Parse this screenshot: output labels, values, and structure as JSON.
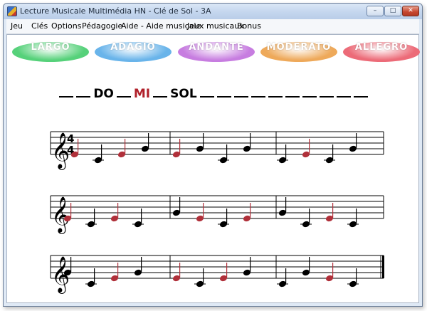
{
  "window": {
    "title": "Lecture Musicale Multimédia HN - Clé de Sol - 3A",
    "buttons": {
      "minimize": "–",
      "maximize": "□",
      "close": "✕"
    }
  },
  "menu": [
    "Jeu",
    "Clés",
    "Options",
    "Pédagogie",
    "Aide - Aide musicale",
    "Jeux musicaux",
    "Bonus"
  ],
  "tempos": [
    {
      "label": "LARGO",
      "color": "#56d17a"
    },
    {
      "label": "ADAGIO",
      "color": "#69b4ea"
    },
    {
      "label": "ANDANTE",
      "color": "#c77de0"
    },
    {
      "label": "MODERATO",
      "color": "#eea95a"
    },
    {
      "label": "ALLEGRO",
      "color": "#ec6b78"
    }
  ],
  "answer": {
    "tokens": [
      "_",
      "_",
      "DO",
      "_",
      "MI",
      "_",
      "SOL",
      "_",
      "_",
      "_",
      "_",
      "_",
      "_",
      "_",
      "_",
      "_",
      "_"
    ],
    "highlight_index": 4,
    "highlight_color": "#b0202a"
  },
  "music": {
    "clef": "treble",
    "time_signature": {
      "top": "4",
      "bottom": "4"
    },
    "note_colors": {
      "answered": "#b0303a",
      "pending": "#000000"
    },
    "staves": [
      {
        "measures": [
          [
            {
              "step": 2,
              "state": "answered"
            },
            {
              "step": 0,
              "state": "pending"
            },
            {
              "step": 2,
              "state": "answered"
            },
            {
              "step": 4,
              "state": "pending"
            }
          ],
          [
            {
              "step": 2,
              "state": "answered"
            },
            {
              "step": 4,
              "state": "pending"
            },
            {
              "step": 0,
              "state": "pending"
            },
            {
              "step": 4,
              "state": "pending"
            }
          ],
          [
            {
              "step": 0,
              "state": "pending"
            },
            {
              "step": 2,
              "state": "answered"
            },
            {
              "step": 0,
              "state": "pending"
            },
            {
              "step": 4,
              "state": "pending"
            }
          ]
        ]
      },
      {
        "measures": [
          [
            {
              "step": 2,
              "state": "answered"
            },
            {
              "step": 0,
              "state": "pending"
            },
            {
              "step": 2,
              "state": "answered"
            },
            {
              "step": 0,
              "state": "pending"
            }
          ],
          [
            {
              "step": 4,
              "state": "pending"
            },
            {
              "step": 2,
              "state": "answered"
            },
            {
              "step": 0,
              "state": "pending"
            },
            {
              "step": 2,
              "state": "answered"
            }
          ],
          [
            {
              "step": 4,
              "state": "pending"
            },
            {
              "step": 0,
              "state": "pending"
            },
            {
              "step": 2,
              "state": "answered"
            },
            {
              "step": 0,
              "state": "pending"
            }
          ]
        ]
      },
      {
        "measures": [
          [
            {
              "step": 4,
              "state": "pending"
            },
            {
              "step": 0,
              "state": "pending"
            },
            {
              "step": 2,
              "state": "answered"
            },
            {
              "step": 4,
              "state": "pending"
            }
          ],
          [
            {
              "step": 2,
              "state": "answered"
            },
            {
              "step": 0,
              "state": "pending"
            },
            {
              "step": 2,
              "state": "answered"
            },
            {
              "step": 4,
              "state": "pending"
            }
          ],
          [
            {
              "step": 0,
              "state": "pending"
            },
            {
              "step": 4,
              "state": "pending"
            },
            {
              "step": 2,
              "state": "answered"
            },
            {
              "step": 0,
              "state": "pending"
            }
          ]
        ]
      }
    ]
  }
}
